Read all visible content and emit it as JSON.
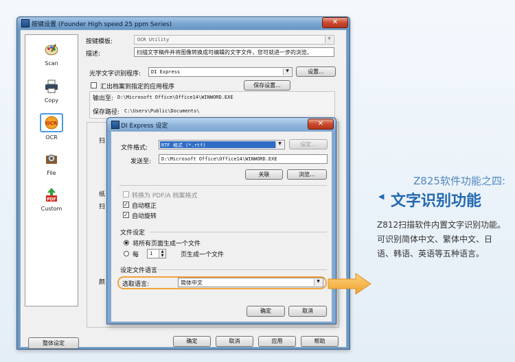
{
  "colors": {
    "accent": "#2268b0",
    "subtitle": "#4f87c0",
    "highlight": "#f2a33a"
  },
  "main_window": {
    "title": "按键设置 (Founder High speed 25 ppm Series)",
    "close_label": "✕",
    "sidebar": {
      "items": [
        {
          "label": "Scan",
          "icon": "scanner-palette-icon"
        },
        {
          "label": "Copy",
          "icon": "printer-icon"
        },
        {
          "label": "OCR",
          "icon": "ocr-icon"
        },
        {
          "label": "File",
          "icon": "file-gear-icon"
        },
        {
          "label": "Custom",
          "icon": "pdf-icon"
        }
      ]
    },
    "template_label": "按键模板:",
    "template_value": "OCR Utility",
    "desc_label": "描述:",
    "desc_value": "扫描文字稿件并将图像转换成可编辑的文字文件，您可就进一步的浏览、",
    "ocr_program_label": "光学文字识别程序:",
    "ocr_program_value": "DI Express",
    "settings_button": "设置...",
    "collect_label": "汇出档案到指定的应用程序",
    "save_settings_button": "保存设置...",
    "output_label": "输出至:",
    "output_value": "D:\\Microsoft Office\\Office14\\WINWORD.EXE",
    "save_path_label": "保存路径:",
    "save_path_value": "C:\\Users\\Public\\Documents\\",
    "partial_labels": {
      "scan": "扫",
      "paper": "纸",
      "scan2": "扫",
      "color": "颜"
    },
    "whole_settings_button": "整体设定",
    "ok_button": "确定",
    "cancel_button": "取消",
    "apply_button": "应用",
    "help_button": "帮助"
  },
  "dialog": {
    "title": "DI Express 设定",
    "close_label": "✕",
    "file_format_label": "文件格式:",
    "file_format_value": "RTF 格式 (*.rtf)",
    "format_settings_button": "设定...",
    "send_to_label": "发送至:",
    "send_to_value": "D:\\Microsoft Office\\Office14\\WINWORD.EXE",
    "link_button": "关联",
    "browse_button": "浏览...",
    "convert_pdfa_label": "转换为 PDF/A 档案格式",
    "auto_deskew_label": "自动框正",
    "auto_rotate_label": "自动旋转",
    "file_settings_title": "文件设定",
    "all_pages_label": "将所有页面生成一个文件",
    "every_label": "每",
    "every_value": "1",
    "pages_one_file_label": "页生成一个文件",
    "language_title": "设定文件语言",
    "select_language_label": "选取语言:",
    "language_value": "简体中文",
    "ok_button": "确定",
    "cancel_button": "取消"
  },
  "info": {
    "subtitle": "Z825软件功能之四:",
    "title": "文字识别功能",
    "body": "Z812扫描软件内置文字识别功能。可识别简体中文、繁体中文、日语、韩语、英语等五种语言。"
  }
}
